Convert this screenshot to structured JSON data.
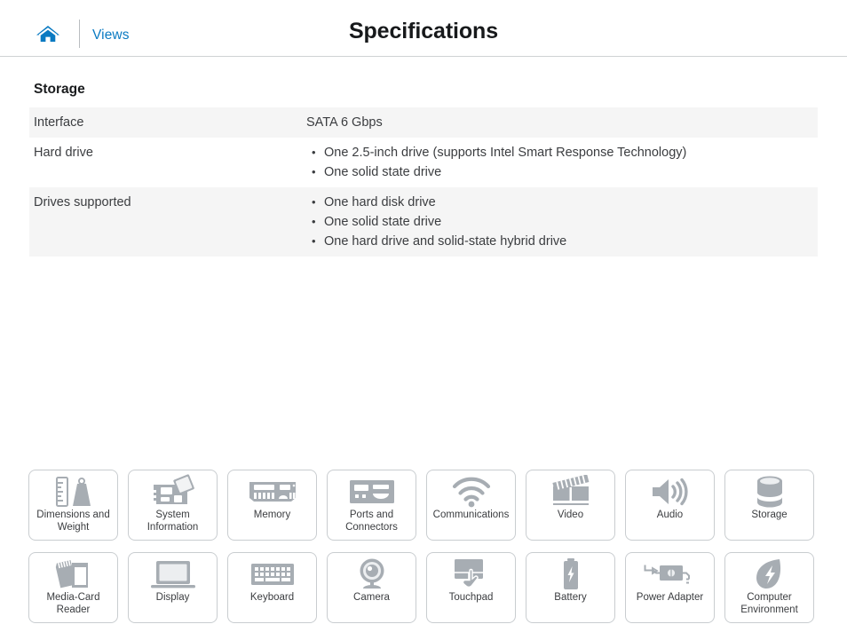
{
  "header": {
    "home_icon": "home-icon",
    "views_label": "Views",
    "title": "Specifications"
  },
  "section": {
    "title": "Storage",
    "rows": [
      {
        "label": "Interface",
        "type": "text",
        "value": "SATA 6 Gbps",
        "shaded": true
      },
      {
        "label": "Hard drive",
        "type": "list",
        "items": [
          "One 2.5-inch drive (supports Intel Smart Response Technology)",
          "One solid state drive"
        ],
        "shaded": false
      },
      {
        "label": "Drives supported",
        "type": "list",
        "items": [
          "One hard disk drive",
          "One solid state drive",
          "One hard drive and solid-state hybrid drive"
        ],
        "shaded": true
      }
    ]
  },
  "tiles": {
    "row1": [
      {
        "label": "Dimensions and Weight",
        "icon": "ruler-and-weight-icon"
      },
      {
        "label": "System Information",
        "icon": "motherboard-icon"
      },
      {
        "label": "Memory",
        "icon": "memory-module-icon"
      },
      {
        "label": "Ports and Connectors",
        "icon": "ports-icon"
      },
      {
        "label": "Communications",
        "icon": "wifi-icon"
      },
      {
        "label": "Video",
        "icon": "clapperboard-icon"
      },
      {
        "label": "Audio",
        "icon": "speaker-icon"
      },
      {
        "label": "Storage",
        "icon": "database-cylinder-icon"
      }
    ],
    "row2": [
      {
        "label": "Media-Card Reader",
        "icon": "memory-cards-icon"
      },
      {
        "label": "Display",
        "icon": "laptop-screen-icon"
      },
      {
        "label": "Keyboard",
        "icon": "keyboard-icon"
      },
      {
        "label": "Camera",
        "icon": "webcam-icon"
      },
      {
        "label": "Touchpad",
        "icon": "touchpad-hand-icon"
      },
      {
        "label": "Battery",
        "icon": "battery-icon"
      },
      {
        "label": "Power Adapter",
        "icon": "power-adapter-icon"
      },
      {
        "label": "Computer Environment",
        "icon": "leaf-icon"
      }
    ]
  },
  "colors": {
    "link": "#0a7ac2",
    "home_icon": "#0a7ac2",
    "icon_gray": "#a7adb3",
    "row_shade": "#f5f5f5",
    "text": "#3b3d40"
  }
}
